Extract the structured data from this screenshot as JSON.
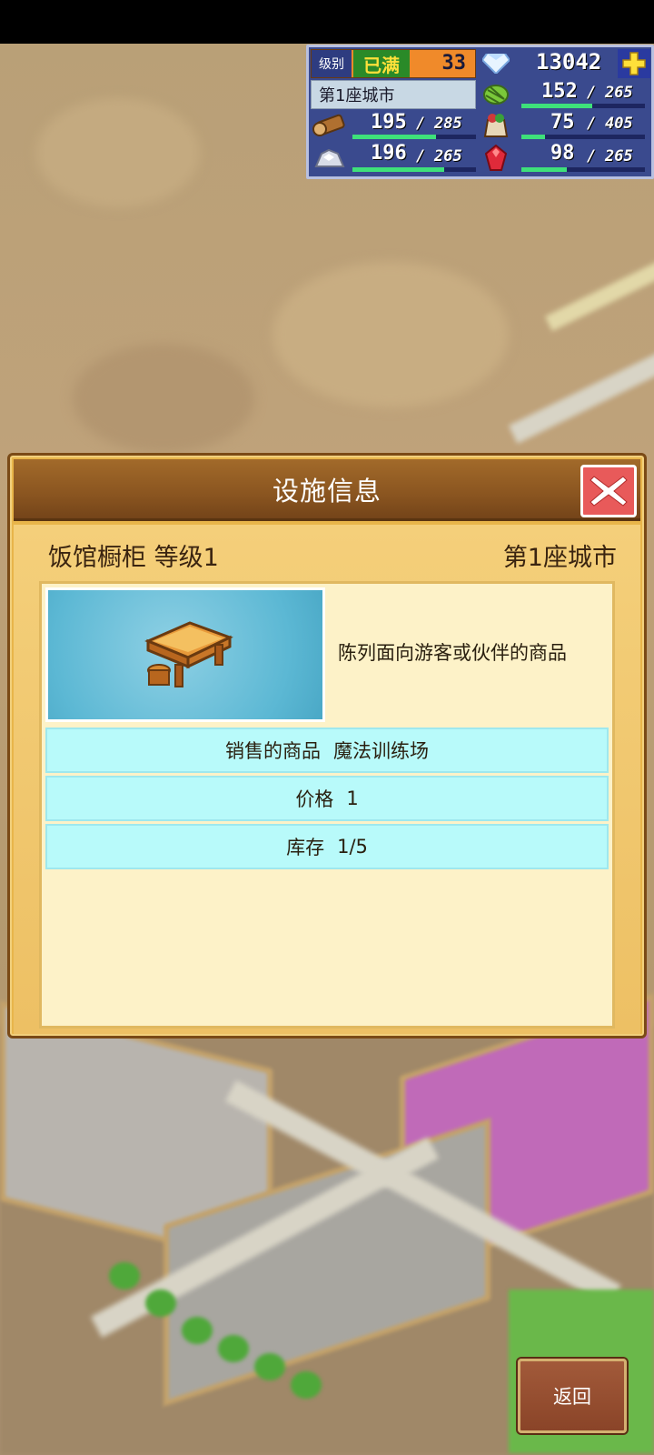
{
  "hud": {
    "level_label": "级别",
    "level_status": "已满",
    "level": "33",
    "gems": "13042",
    "city": "第1座城市",
    "resources": [
      {
        "icon": "crop-icon",
        "current": "152",
        "max": "265",
        "fill": 0.57
      },
      {
        "icon": "wood-log-icon",
        "current": "195",
        "max": "285",
        "fill": 0.68
      },
      {
        "icon": "food-sack-icon",
        "current": "75",
        "max": "405",
        "fill": 0.19
      },
      {
        "icon": "ore-icon",
        "current": "196",
        "max": "265",
        "fill": 0.74
      },
      {
        "icon": "ruby-icon",
        "current": "98",
        "max": "265",
        "fill": 0.37
      }
    ],
    "separator": "/"
  },
  "dialog": {
    "title": "设施信息",
    "facility_name": "饭馆橱柜 等级1",
    "city": "第1座城市",
    "description": "陈列面向游客或伙伴的商品",
    "rows": [
      {
        "label": "销售的商品",
        "value": "魔法训练场"
      },
      {
        "label": "价格",
        "value": "1"
      },
      {
        "label": "库存",
        "value": "1/5"
      }
    ]
  },
  "back_label": "返回",
  "colors": {
    "accent_green": "#3ee07a",
    "close_red": "#e85a5a",
    "row_cyan": "#b8fafa"
  }
}
